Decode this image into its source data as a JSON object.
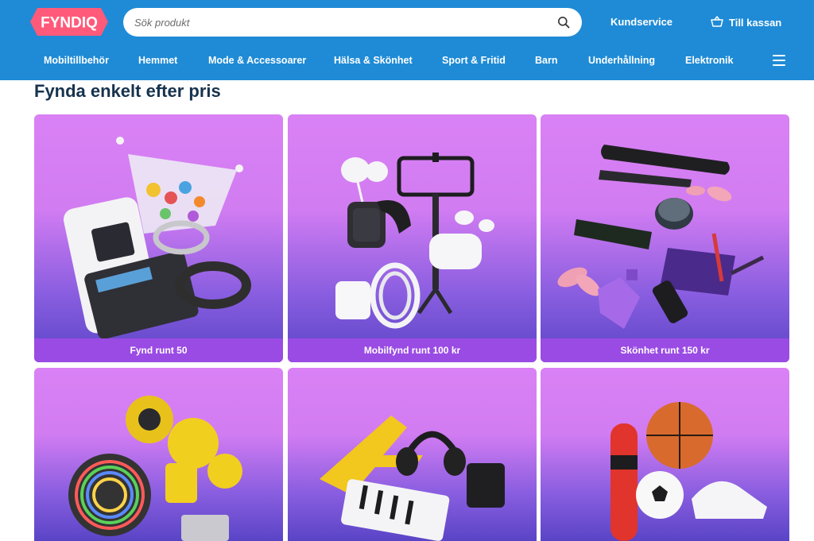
{
  "header": {
    "logo_text": "FYNDIQ",
    "search": {
      "placeholder": "Sök produkt",
      "value": ""
    },
    "links": {
      "kundservice": "Kundservice",
      "checkout": "Till kassan"
    },
    "nav": [
      "Mobiltillbehör",
      "Hemmet",
      "Mode & Accessoarer",
      "Hälsa & Skönhet",
      "Sport & Fritid",
      "Barn",
      "Underhållning",
      "Elektronik"
    ]
  },
  "main": {
    "section_title": "Fynda enkelt efter pris",
    "cards": [
      {
        "label": "Fynd runt 50"
      },
      {
        "label": "Mobilfynd runt 100 kr"
      },
      {
        "label": "Skönhet runt 150 kr"
      },
      {
        "label": ""
      },
      {
        "label": ""
      },
      {
        "label": ""
      }
    ]
  },
  "colors": {
    "header_bg": "#1f8bd6",
    "logo_bg": "#ff5a7a",
    "title": "#17334d",
    "card_top": "#d981f5",
    "card_bottom": "#5a44c6",
    "card_label_bg": "#9a4be4"
  },
  "icons": [
    "search-icon",
    "basket-icon",
    "hamburger-menu-icon"
  ]
}
